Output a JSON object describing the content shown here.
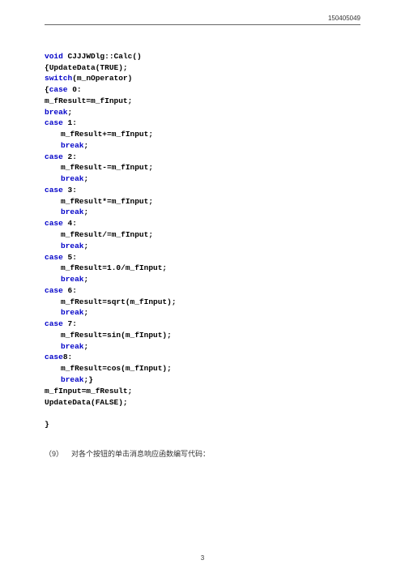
{
  "header_id": "150405049",
  "code": {
    "l1_kw": "void",
    "l1_rest": " CJJJWDlg::Calc()",
    "l2": "{UpdateData(TRUE);",
    "l3_kw": "switch",
    "l3_rest": "(m_nOperator)",
    "l4a": "{",
    "l4_kw": "case",
    "l4b": " 0:",
    "l5": "m_fResult=m_fInput;",
    "l6_kw": "break",
    "l6b": ";",
    "l7_kw": "case",
    "l7b": " 1:",
    "l8": "m_fResult+=m_fInput;",
    "l9_kw": "break",
    "l9b": ";",
    "l10_kw": "case",
    "l10b": " 2:",
    "l11": "m_fResult-=m_fInput;",
    "l12_kw": "break",
    "l12b": ";",
    "l13_kw": "case",
    "l13b": " 3:",
    "l14": "m_fResult*=m_fInput;",
    "l15_kw": "break",
    "l15b": ";",
    "l16_kw": "case",
    "l16b": " 4:",
    "l17": "m_fResult/=m_fInput;",
    "l18_kw": "break",
    "l18b": ";",
    "l19_kw": "case",
    "l19b": " 5:",
    "l20": "m_fResult=1.0/m_fInput;",
    "l21_kw": "break",
    "l21b": ";",
    "l22_kw": "case",
    "l22b": " 6:",
    "l23": "m_fResult=sqrt(m_fInput);",
    "l24_kw": "break",
    "l24b": ";",
    "l25_kw": "case",
    "l25b": " 7:",
    "l26": "m_fResult=sin(m_fInput);",
    "l27_kw": "break",
    "l27b": ";",
    "l28_kw": "case",
    "l28b": "8:",
    "l29": "m_fResult=cos(m_fInput);",
    "l30_kw": "break",
    "l30b": ";}",
    "l31": "m_fInput=m_fResult;",
    "l32": "UpdateData(FALSE);",
    "l33": "}"
  },
  "caption": {
    "num": "（9）",
    "text": "对各个按钮的单击消息响应函数编写代码："
  },
  "page_number": "3"
}
